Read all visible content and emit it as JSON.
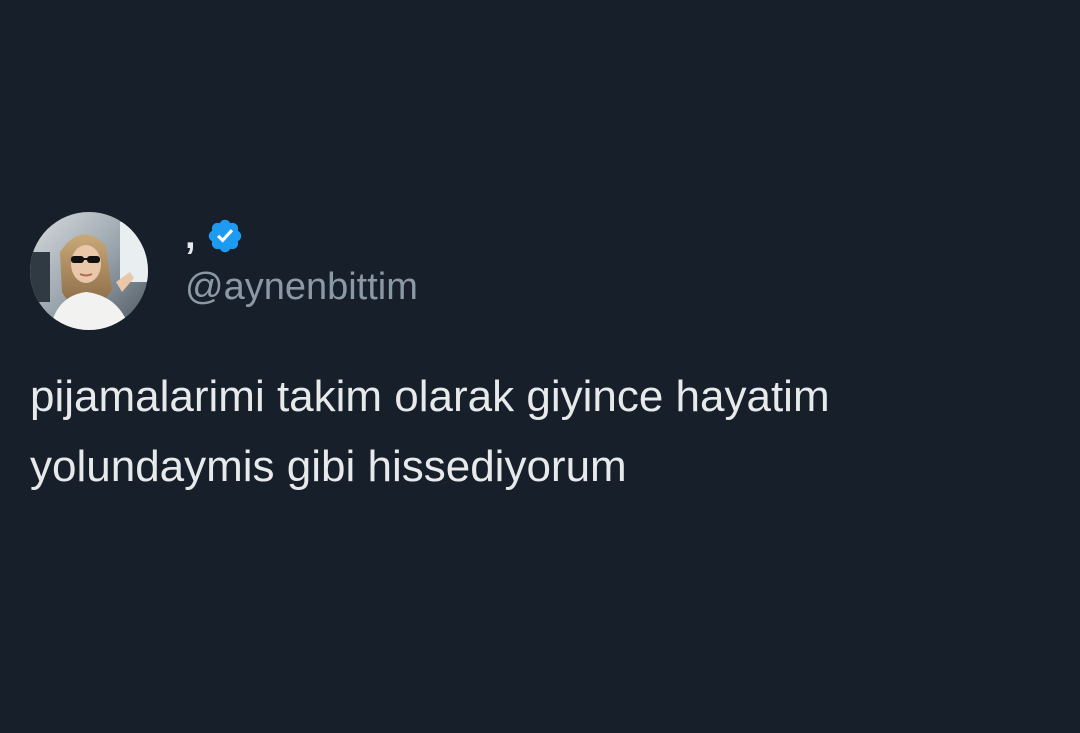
{
  "tweet": {
    "author": {
      "display_name": ",",
      "handle": "@aynenbittim",
      "verified": true,
      "avatar_description": "profile-photo"
    },
    "text_lines": [
      "pijamalarimi takim olarak giyince hayatim",
      "yolundaymis gibi hissediyorum"
    ]
  },
  "colors": {
    "background": "#17202a",
    "text_primary": "#e7e9ea",
    "text_secondary": "#8b98a5",
    "verified_blue": "#1d9bf0"
  },
  "icons": {
    "verified": "verified-badge-icon"
  }
}
